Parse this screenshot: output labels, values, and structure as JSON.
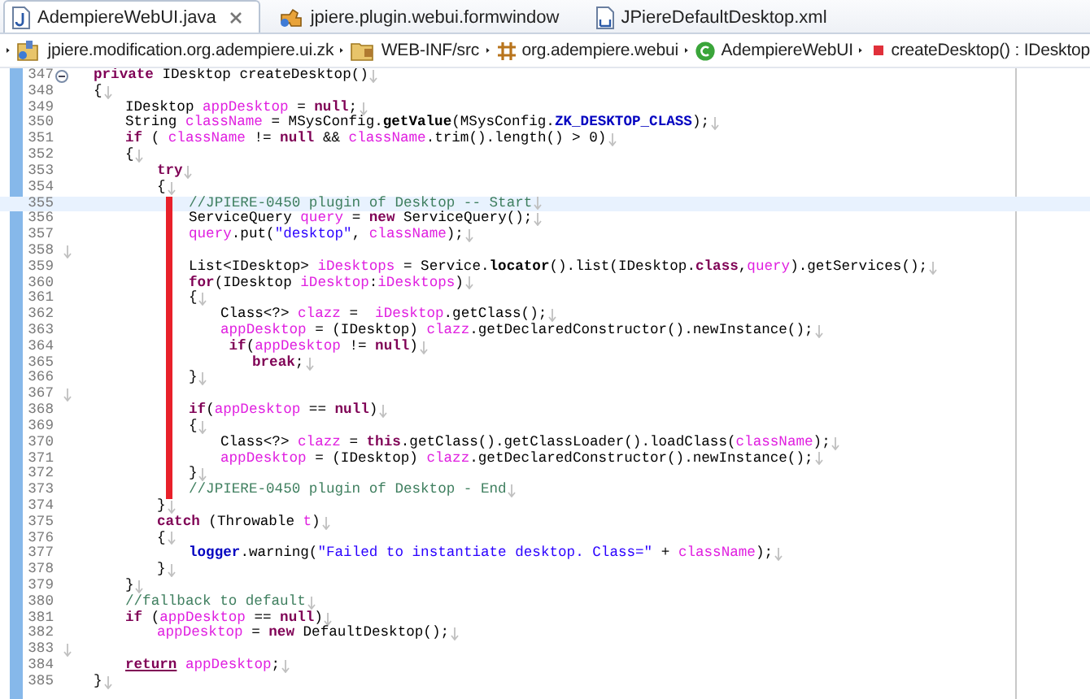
{
  "tabs": [
    {
      "label": "AdempiereWebUI.java",
      "kind": "java",
      "selected": true,
      "closable": true
    },
    {
      "label": "jpiere.plugin.webui.formwindow",
      "kind": "plugin",
      "selected": false,
      "closable": false
    },
    {
      "label": "JPiereDefaultDesktop.xml",
      "kind": "xml",
      "selected": false,
      "closable": false
    }
  ],
  "breadcrumb": [
    {
      "label": "jpiere.modification.org.adempiere.ui.zk",
      "kind": "project"
    },
    {
      "label": "WEB-INF/src",
      "kind": "source"
    },
    {
      "label": "org.adempiere.webui",
      "kind": "package"
    },
    {
      "label": "AdempiereWebUI",
      "kind": "class"
    },
    {
      "label": "createDesktop() : IDesktop",
      "kind": "method"
    }
  ],
  "editor": {
    "lines": [
      {
        "number": "347",
        "fold": true,
        "current": false,
        "marked": false,
        "tokens": [
          {
            "text": "\tprivate",
            "kind": "keyword"
          },
          {
            "text": " IDesktop createDesktop()"
          }
        ]
      },
      {
        "number": "348",
        "fold": false,
        "current": false,
        "marked": false,
        "tokens": [
          {
            "text": "\t{"
          }
        ]
      },
      {
        "number": "349",
        "fold": false,
        "current": false,
        "marked": false,
        "tokens": [
          {
            "text": "\t\tIDesktop "
          },
          {
            "text": "appDesktop",
            "kind": "field"
          },
          {
            "text": " = "
          },
          {
            "text": "null",
            "kind": "keyword"
          },
          {
            "text": ";"
          }
        ]
      },
      {
        "number": "350",
        "fold": false,
        "current": false,
        "marked": false,
        "tokens": [
          {
            "text": "\t\tString "
          },
          {
            "text": "className",
            "kind": "field"
          },
          {
            "text": " = MSysConfig."
          },
          {
            "text": "getValue",
            "kind": "static_method"
          },
          {
            "text": "(MSysConfig."
          },
          {
            "text": "ZK_DESKTOP_CLASS",
            "kind": "constant"
          },
          {
            "text": ");"
          }
        ]
      },
      {
        "number": "351",
        "fold": false,
        "current": false,
        "marked": false,
        "tokens": [
          {
            "text": "\t\tif",
            "kind": "keyword"
          },
          {
            "text": " ( "
          },
          {
            "text": "className",
            "kind": "field"
          },
          {
            "text": " != "
          },
          {
            "text": "null",
            "kind": "keyword"
          },
          {
            "text": " && "
          },
          {
            "text": "className",
            "kind": "field"
          },
          {
            "text": ".trim().length() > 0)"
          }
        ]
      },
      {
        "number": "352",
        "fold": false,
        "current": false,
        "marked": false,
        "tokens": [
          {
            "text": "\t\t{"
          }
        ]
      },
      {
        "number": "353",
        "fold": false,
        "current": false,
        "marked": false,
        "tokens": [
          {
            "text": "\t\t\ttry",
            "kind": "keyword"
          }
        ]
      },
      {
        "number": "354",
        "fold": false,
        "current": false,
        "marked": false,
        "tokens": [
          {
            "text": "\t\t\t{"
          }
        ]
      },
      {
        "number": "355",
        "fold": false,
        "current": true,
        "marked": true,
        "tokens": [
          {
            "text": "\t\t\t\t//JPIERE-0450 plugin of Desktop -- Start",
            "kind": "comment"
          }
        ]
      },
      {
        "number": "356",
        "fold": false,
        "current": false,
        "marked": true,
        "tokens": [
          {
            "text": "\t\t\t\tServiceQuery "
          },
          {
            "text": "query",
            "kind": "field"
          },
          {
            "text": " = "
          },
          {
            "text": "new",
            "kind": "keyword"
          },
          {
            "text": " ServiceQuery();"
          }
        ]
      },
      {
        "number": "357",
        "fold": false,
        "current": false,
        "marked": true,
        "tokens": [
          {
            "text": "\t\t\t\tquery",
            "kind": "field"
          },
          {
            "text": ".put("
          },
          {
            "text": "\"desktop\"",
            "kind": "string"
          },
          {
            "text": ", "
          },
          {
            "text": "className",
            "kind": "field"
          },
          {
            "text": ");"
          }
        ]
      },
      {
        "number": "358",
        "fold": false,
        "current": false,
        "marked": true
      },
      {
        "number": "359",
        "fold": false,
        "current": false,
        "marked": true,
        "tokens": [
          {
            "text": "\t\t\t\tList<IDesktop> "
          },
          {
            "text": "iDesktops",
            "kind": "field"
          },
          {
            "text": " = Service."
          },
          {
            "text": "locator",
            "kind": "static_method"
          },
          {
            "text": "().list(IDesktop."
          },
          {
            "text": "class",
            "kind": "keyword"
          },
          {
            "text": ","
          },
          {
            "text": "query",
            "kind": "field"
          },
          {
            "text": ").getServices();"
          }
        ]
      },
      {
        "number": "360",
        "fold": false,
        "current": false,
        "marked": true,
        "tokens": [
          {
            "text": "\t\t\t\tfor",
            "kind": "keyword"
          },
          {
            "text": "(IDesktop "
          },
          {
            "text": "iDesktop",
            "kind": "field"
          },
          {
            "text": ":"
          },
          {
            "text": "iDesktops",
            "kind": "field"
          },
          {
            "text": ")"
          }
        ]
      },
      {
        "number": "361",
        "fold": false,
        "current": false,
        "marked": true,
        "tokens": [
          {
            "text": "\t\t\t\t{"
          }
        ]
      },
      {
        "number": "362",
        "fold": false,
        "current": false,
        "marked": true,
        "tokens": [
          {
            "text": "\t\t\t\t\tClass<?> "
          },
          {
            "text": "clazz",
            "kind": "field"
          },
          {
            "text": " =  "
          },
          {
            "text": "iDesktop",
            "kind": "field"
          },
          {
            "text": ".getClass();"
          }
        ]
      },
      {
        "number": "363",
        "fold": false,
        "current": false,
        "marked": true,
        "tokens": [
          {
            "text": "\t\t\t\t\tappDesktop",
            "kind": "field"
          },
          {
            "text": " = (IDesktop) "
          },
          {
            "text": "clazz",
            "kind": "field"
          },
          {
            "text": ".getDeclaredConstructor().newInstance();"
          }
        ]
      },
      {
        "number": "364",
        "fold": false,
        "current": false,
        "marked": true,
        "tokens": [
          {
            "text": "\t\t\t\t\t if",
            "kind": "keyword"
          },
          {
            "text": "("
          },
          {
            "text": "appDesktop",
            "kind": "field"
          },
          {
            "text": " != "
          },
          {
            "text": "null",
            "kind": "keyword"
          },
          {
            "text": ")"
          }
        ]
      },
      {
        "number": "365",
        "fold": false,
        "current": false,
        "marked": true,
        "tokens": [
          {
            "text": "\t\t\t\t\t\tbreak",
            "kind": "keyword"
          },
          {
            "text": ";"
          }
        ]
      },
      {
        "number": "366",
        "fold": false,
        "current": false,
        "marked": true,
        "tokens": [
          {
            "text": "\t\t\t\t}"
          }
        ]
      },
      {
        "number": "367",
        "fold": false,
        "current": false,
        "marked": true
      },
      {
        "number": "368",
        "fold": false,
        "current": false,
        "marked": true,
        "tokens": [
          {
            "text": "\t\t\t\tif",
            "kind": "keyword"
          },
          {
            "text": "("
          },
          {
            "text": "appDesktop",
            "kind": "field"
          },
          {
            "text": " == "
          },
          {
            "text": "null",
            "kind": "keyword"
          },
          {
            "text": ")"
          }
        ]
      },
      {
        "number": "369",
        "fold": false,
        "current": false,
        "marked": true,
        "tokens": [
          {
            "text": "\t\t\t\t{"
          }
        ]
      },
      {
        "number": "370",
        "fold": false,
        "current": false,
        "marked": true,
        "tokens": [
          {
            "text": "\t\t\t\t\tClass<?> "
          },
          {
            "text": "clazz",
            "kind": "field"
          },
          {
            "text": " = "
          },
          {
            "text": "this",
            "kind": "keyword"
          },
          {
            "text": ".getClass().getClassLoader().loadClass("
          },
          {
            "text": "className",
            "kind": "field"
          },
          {
            "text": ");"
          }
        ]
      },
      {
        "number": "371",
        "fold": false,
        "current": false,
        "marked": true,
        "tokens": [
          {
            "text": "\t\t\t\t\tappDesktop",
            "kind": "field"
          },
          {
            "text": " = (IDesktop) "
          },
          {
            "text": "clazz",
            "kind": "field"
          },
          {
            "text": ".getDeclaredConstructor().newInstance();"
          }
        ]
      },
      {
        "number": "372",
        "fold": false,
        "current": false,
        "marked": true,
        "tokens": [
          {
            "text": "\t\t\t\t}"
          }
        ]
      },
      {
        "number": "373",
        "fold": false,
        "current": false,
        "marked": true,
        "tokens": [
          {
            "text": "\t\t\t\t//JPIERE-0450 plugin of Desktop - End",
            "kind": "comment"
          }
        ]
      },
      {
        "number": "374",
        "fold": false,
        "current": false,
        "marked": false,
        "tokens": [
          {
            "text": "\t\t\t}"
          }
        ]
      },
      {
        "number": "375",
        "fold": false,
        "current": false,
        "marked": false,
        "tokens": [
          {
            "text": "\t\t\tcatch",
            "kind": "keyword"
          },
          {
            "text": " (Throwable "
          },
          {
            "text": "t",
            "kind": "field"
          },
          {
            "text": ")"
          }
        ]
      },
      {
        "number": "376",
        "fold": false,
        "current": false,
        "marked": false,
        "tokens": [
          {
            "text": "\t\t\t{"
          }
        ]
      },
      {
        "number": "377",
        "fold": false,
        "current": false,
        "marked": false,
        "tokens": [
          {
            "text": "\t\t\t\tlogger",
            "kind": "constant"
          },
          {
            "text": ".warning("
          },
          {
            "text": "\"Failed to instantiate desktop. Class=\"",
            "kind": "string"
          },
          {
            "text": " + "
          },
          {
            "text": "className",
            "kind": "field"
          },
          {
            "text": ");"
          }
        ]
      },
      {
        "number": "378",
        "fold": false,
        "current": false,
        "marked": false,
        "tokens": [
          {
            "text": "\t\t\t}"
          }
        ]
      },
      {
        "number": "379",
        "fold": false,
        "current": false,
        "marked": false,
        "tokens": [
          {
            "text": "\t\t}"
          }
        ]
      },
      {
        "number": "380",
        "fold": false,
        "current": false,
        "marked": false,
        "tokens": [
          {
            "text": "\t\t//fallback to default",
            "kind": "comment"
          }
        ]
      },
      {
        "number": "381",
        "fold": false,
        "current": false,
        "marked": false,
        "tokens": [
          {
            "text": "\t\tif",
            "kind": "keyword"
          },
          {
            "text": " ("
          },
          {
            "text": "appDesktop",
            "kind": "field"
          },
          {
            "text": " == "
          },
          {
            "text": "null",
            "kind": "keyword"
          },
          {
            "text": ")"
          }
        ]
      },
      {
        "number": "382",
        "fold": false,
        "current": false,
        "marked": false,
        "tokens": [
          {
            "text": "\t\t\tappDesktop",
            "kind": "field"
          },
          {
            "text": " = "
          },
          {
            "text": "new",
            "kind": "keyword"
          },
          {
            "text": " DefaultDesktop();"
          }
        ]
      },
      {
        "number": "383",
        "fold": false,
        "current": false,
        "marked": false
      },
      {
        "number": "384",
        "fold": false,
        "current": false,
        "marked": false,
        "tokens": [
          {
            "text": "\t\treturn",
            "kind": "exit_keyword"
          },
          {
            "text": " appDesktop",
            "kind": "field"
          },
          {
            "text": ";"
          }
        ]
      },
      {
        "number": "385",
        "fold": false,
        "current": false,
        "marked": false,
        "tokens": [
          {
            "text": "\t}"
          }
        ]
      }
    ]
  }
}
